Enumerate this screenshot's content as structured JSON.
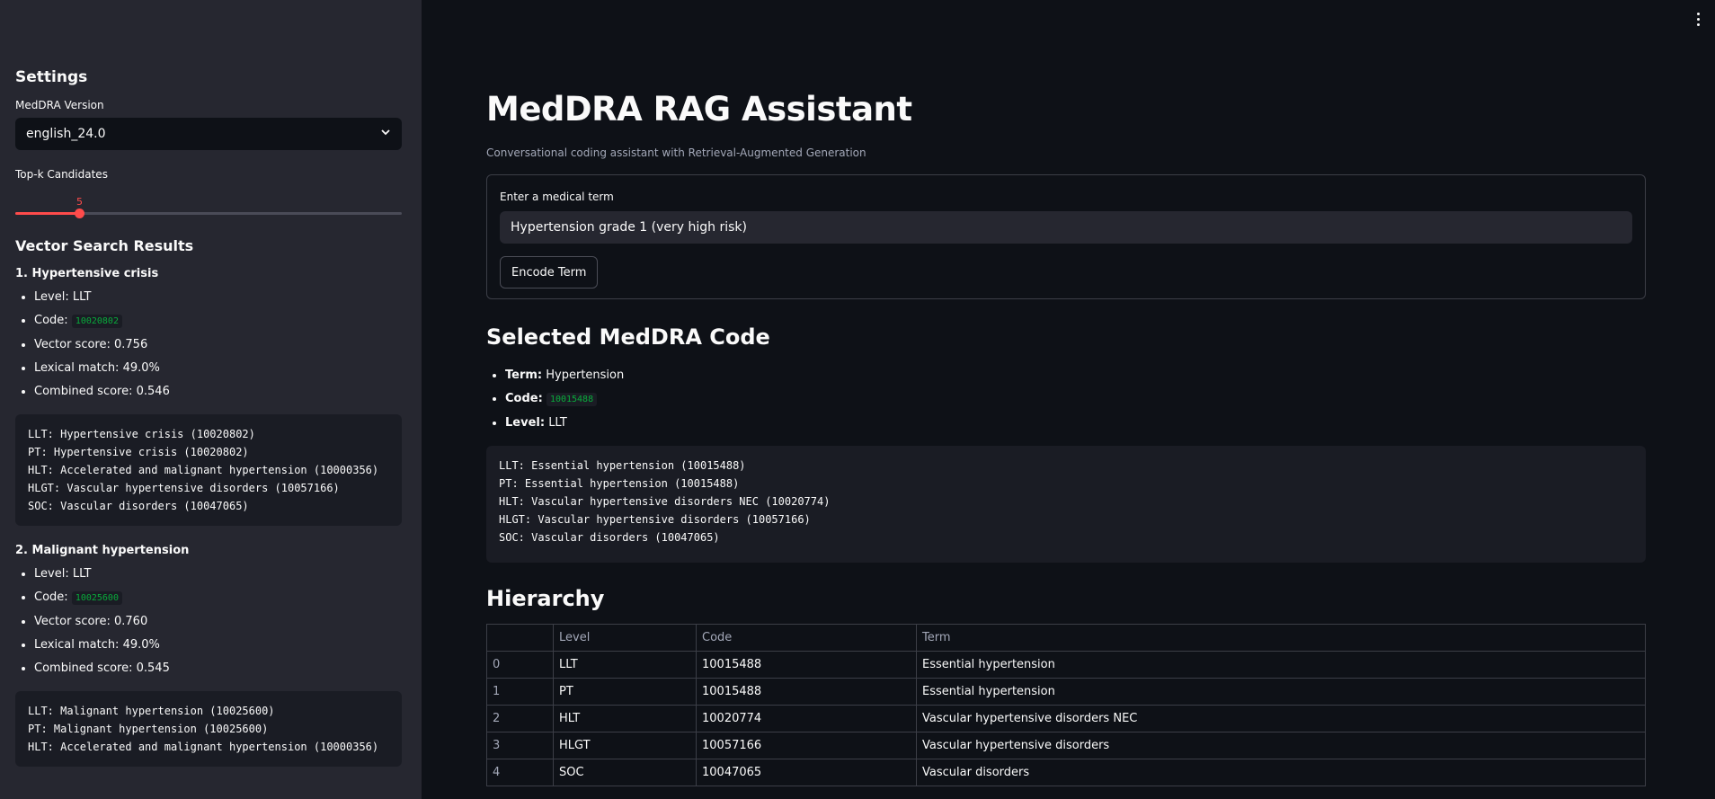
{
  "sidebar": {
    "title": "Settings",
    "version_label": "MedDRA Version",
    "version_value": "english_24.0",
    "topk_label": "Top-k Candidates",
    "topk_value": "5",
    "topk_range": {
      "min": 1,
      "max": 25,
      "value": 5
    },
    "results_title": "Vector Search Results",
    "results": [
      {
        "title": "1. Hypertensive crisis",
        "level": "Level: LLT",
        "code_label": "Code:",
        "code": "10020802",
        "vector_score": "Vector score: 0.756",
        "lexical_match": "Lexical match: 49.0%",
        "combined_score": "Combined score: 0.546",
        "hierarchy": "LLT: Hypertensive crisis (10020802)\nPT: Hypertensive crisis (10020802)\nHLT: Accelerated and malignant hypertension (10000356)\nHLGT: Vascular hypertensive disorders (10057166)\nSOC: Vascular disorders (10047065)"
      },
      {
        "title": "2. Malignant hypertension",
        "level": "Level: LLT",
        "code_label": "Code:",
        "code": "10025600",
        "vector_score": "Vector score: 0.760",
        "lexical_match": "Lexical match: 49.0%",
        "combined_score": "Combined score: 0.545",
        "hierarchy": "LLT: Malignant hypertension (10025600)\nPT: Malignant hypertension (10025600)\nHLT: Accelerated and malignant hypertension (10000356)"
      }
    ]
  },
  "main": {
    "title": "MedDRA RAG Assistant",
    "caption": "Conversational coding assistant with Retrieval-Augmented Generation",
    "input_label": "Enter a medical term",
    "input_value": "Hypertension grade 1 (very high risk)",
    "encode_button": "Encode Term",
    "selected_title": "Selected MedDRA Code",
    "selected": {
      "term_label": "Term:",
      "term": "Hypertension",
      "code_label": "Code:",
      "code": "10015488",
      "level_label": "Level:",
      "level": "LLT"
    },
    "selected_hierarchy": "LLT: Essential hypertension (10015488)\nPT: Essential hypertension (10015488)\nHLT: Vascular hypertensive disorders NEC (10020774)\nHLGT: Vascular hypertensive disorders (10057166)\nSOC: Vascular disorders (10047065)",
    "hierarchy_title": "Hierarchy",
    "table": {
      "headers": [
        "",
        "Level",
        "Code",
        "Term"
      ],
      "rows": [
        [
          "0",
          "LLT",
          "10015488",
          "Essential hypertension"
        ],
        [
          "1",
          "PT",
          "10015488",
          "Essential hypertension"
        ],
        [
          "2",
          "HLT",
          "10020774",
          "Vascular hypertensive disorders NEC"
        ],
        [
          "3",
          "HLGT",
          "10057166",
          "Vascular hypertensive disorders"
        ],
        [
          "4",
          "SOC",
          "10047065",
          "Vascular disorders"
        ]
      ]
    }
  },
  "colors": {
    "accent": "#ff4b4b",
    "code": "#09ab3b",
    "sidebar_bg": "#262730",
    "main_bg": "#0e1117"
  },
  "icons": {
    "select_arrow": "chevron-down-icon",
    "menu": "kebab-menu-icon"
  }
}
